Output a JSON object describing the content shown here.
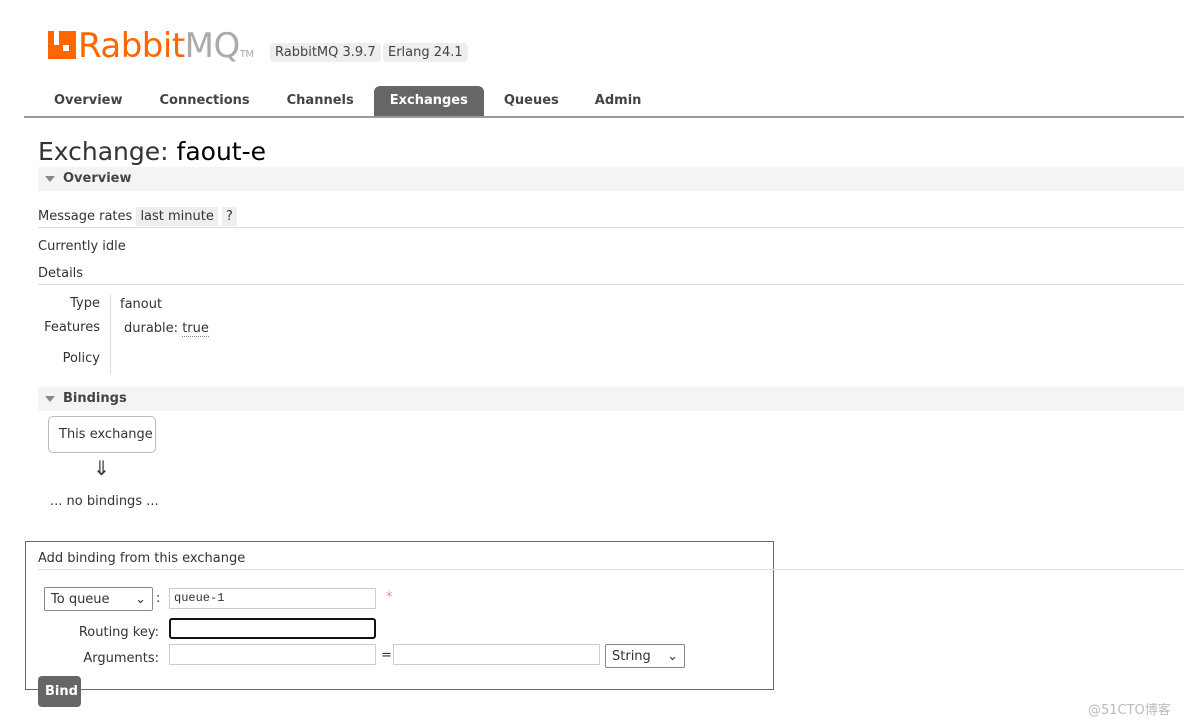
{
  "header": {
    "logo_brand": "Rabbit",
    "logo_product": "MQ",
    "logo_tm": "TM",
    "version": "RabbitMQ 3.9.7",
    "erlang": "Erlang 24.1"
  },
  "nav": {
    "tabs": [
      {
        "label": "Overview"
      },
      {
        "label": "Connections"
      },
      {
        "label": "Channels"
      },
      {
        "label": "Exchanges",
        "active": true
      },
      {
        "label": "Queues"
      },
      {
        "label": "Admin"
      }
    ]
  },
  "page": {
    "title_prefix": "Exchange:",
    "title_name": "faout-e"
  },
  "overview": {
    "heading": "Overview",
    "message_rates_label": "Message rates",
    "rate_period": "last minute",
    "help": "?",
    "status": "Currently idle",
    "details_label": "Details",
    "type_label": "Type",
    "type_value": "fanout",
    "features_label": "Features",
    "feature_key": "durable:",
    "feature_value": "true",
    "policy_label": "Policy"
  },
  "bindings": {
    "heading": "Bindings",
    "this_exchange": "This exchange",
    "arrow": "⇓",
    "none": "... no bindings ..."
  },
  "add_binding": {
    "heading": "Add binding from this exchange",
    "destination_type": "To queue",
    "colon": ":",
    "destination_value": "queue-1",
    "required": "*",
    "routing_key_label": "Routing key:",
    "routing_key_value": "",
    "arguments_label": "Arguments:",
    "equals": "=",
    "arg_type": "String",
    "bind_label": "Bind"
  },
  "watermark": "@51CTO博客",
  "colors": {
    "accent": "#ff6600",
    "tab_active": "#666666",
    "highlight_box": "#ee3333"
  }
}
